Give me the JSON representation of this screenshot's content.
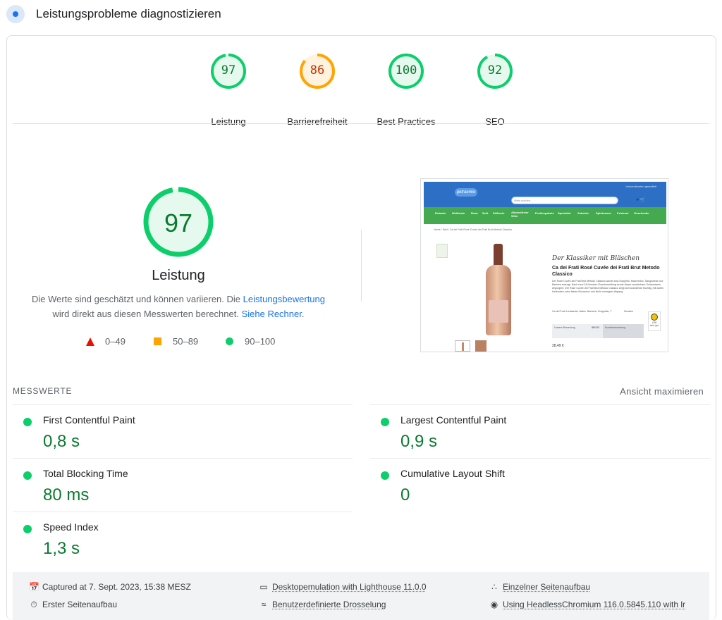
{
  "header": {
    "title": "Leistungsprobleme diagnostizieren"
  },
  "categories": [
    {
      "label": "Leistung",
      "score": 97,
      "color": "#0cce6b",
      "text_color": "#0a7a2f",
      "bg": "#e6f9ee"
    },
    {
      "label": "Barrierefreiheit",
      "score": 86,
      "color": "#ffa400",
      "text_color": "#c33300",
      "bg": "#fff3e0"
    },
    {
      "label": "Best Practices",
      "score": 100,
      "color": "#0cce6b",
      "text_color": "#0a7a2f",
      "bg": "#e6f9ee"
    },
    {
      "label": "SEO",
      "score": 92,
      "color": "#0cce6b",
      "text_color": "#0a7a2f",
      "bg": "#e6f9ee"
    }
  ],
  "performance": {
    "score": 97,
    "label": "Leistung",
    "desc_part1": "Die Werte sind geschätzt und können variieren. Die ",
    "desc_link1": "Leistungsbewertung",
    "desc_part2": " wird direkt aus diesen Messwerten berechnet. ",
    "desc_link2": "Siehe Rechner",
    "desc_end": ".",
    "legend": [
      "0–49",
      "50–89",
      "90–100"
    ]
  },
  "thumbnail": {
    "brand": "getraenke",
    "toptext": "Versandkosten gestaffelt",
    "search_placeholder": "Wein suchen...",
    "nav": [
      "Rotwein",
      "Weißwein",
      "Rosé",
      "Sekt",
      "Süßwein",
      "Alkoholfreier Wein",
      "Probierpakete",
      "Spezialist",
      "Zubehör",
      "Spirituosen",
      "Feinkost",
      "Geschenke"
    ],
    "breadcrumb": "Home  /  Sekt  /  Ca dei Frati Rosé Cuvée dei Frati Brut Metodo Classico",
    "script": "Der Klassiker mit Bläschen",
    "product_title": "Ca dei Frati Rosé Cuvée dei Frati Brut Metodo Classico",
    "product_text": "Der Rosé Cuvée dei Frati Brut Metodo Classico wurde aus Groppello, Marzemino, Sangiovese und Barbera erzeugt. Nach rund 24 Monaten Flaschenreifung wurde dieser wunderbare Schaumwein degorgiert. Der Rosé Cuvée dei Frati Brut Metodo Classico zeigt sich wunderbar fruchtig, mit zarten Hefenoten, sehr feinen Mousseux und leicht cremigem Abgang.",
    "features": [
      "Ca dei Frati Lombardei, Italien",
      "Barbera, Groppello, T",
      "Smoken"
    ],
    "badge_rating": "4.86",
    "badge_sub": "sehr gut",
    "rating_label": "Unsere Bewertung",
    "rating_value": "88/100",
    "rating_right": "Kundenbewertung",
    "price": "28,49 €"
  },
  "metrics": {
    "title": "MESSWERTE",
    "expand_label": "Ansicht maximieren",
    "items": [
      {
        "label": "First Contentful Paint",
        "value": "0,8 s"
      },
      {
        "label": "Largest Contentful Paint",
        "value": "0,9 s"
      },
      {
        "label": "Total Blocking Time",
        "value": "80 ms"
      },
      {
        "label": "Cumulative Layout Shift",
        "value": "0"
      },
      {
        "label": "Speed Index",
        "value": "1,3 s"
      }
    ]
  },
  "footer": [
    {
      "icon": "calendar-icon",
      "text": "Captured at 7. Sept. 2023, 15:38 MESZ",
      "underline": false
    },
    {
      "icon": "device-icon",
      "text": "Desktopemulation with Lighthouse 11.0.0",
      "underline": true
    },
    {
      "icon": "page-load-icon",
      "text": "Einzelner Seitenaufbau",
      "underline": true
    },
    {
      "icon": "stopwatch-icon",
      "text": "Erster Seitenaufbau",
      "underline": false
    },
    {
      "icon": "network-icon",
      "text": "Benutzerdefinierte Drosselung",
      "underline": true
    },
    {
      "icon": "chrome-icon",
      "text": "Using HeadlessChromium 116.0.5845.110 with lr",
      "underline": true
    }
  ]
}
